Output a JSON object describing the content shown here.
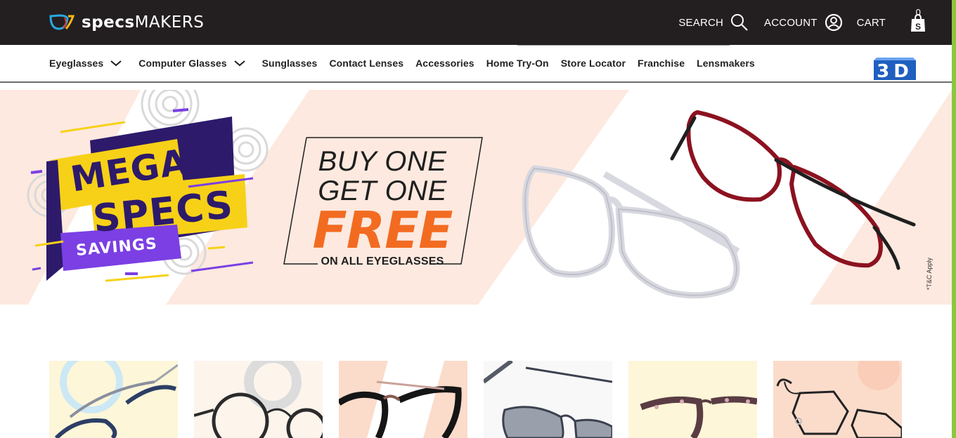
{
  "brand": {
    "name_bold": "specs",
    "name_light": "MAKERS"
  },
  "topnav": {
    "search_label": "SEARCH",
    "account_label": "ACCOUNT",
    "cart_label": "CART",
    "cart_count": "0"
  },
  "menu": {
    "items": [
      {
        "label": "Eyeglasses",
        "dropdown": true
      },
      {
        "label": "Computer Glasses",
        "dropdown": true
      },
      {
        "label": "Sunglasses",
        "dropdown": false
      },
      {
        "label": "Contact Lenses",
        "dropdown": false
      },
      {
        "label": "Accessories",
        "dropdown": false
      },
      {
        "label": "Home Try-On",
        "dropdown": false
      },
      {
        "label": "Store Locator",
        "dropdown": false
      },
      {
        "label": "Franchise",
        "dropdown": false
      },
      {
        "label": "Lensmakers",
        "dropdown": false
      }
    ],
    "badge_label": "3D"
  },
  "banner": {
    "mega_line1": "MEGA",
    "mega_line2": "SPECS",
    "mega_line3": "SAVINGS",
    "offer_line1": "BUY ONE",
    "offer_line2": "GET ONE",
    "offer_line3": "FREE",
    "offer_line4": "ON ALL EYEGLASSES",
    "terms": "*T&C Apply"
  },
  "colors": {
    "topbar": "#231f20",
    "accent_green": "#8cc63f",
    "banner_peach": "#fde9df",
    "mega_purple": "#2d1a6b",
    "mega_yellow": "#f7d117",
    "savings_violet": "#7b3fe4",
    "free_orange": "#f26b21",
    "logo_blue": "#29a8e0"
  },
  "icons": {
    "search": "search-icon",
    "account": "account-icon",
    "cart": "shopping-bag-icon",
    "chevron": "chevron-down-icon"
  }
}
